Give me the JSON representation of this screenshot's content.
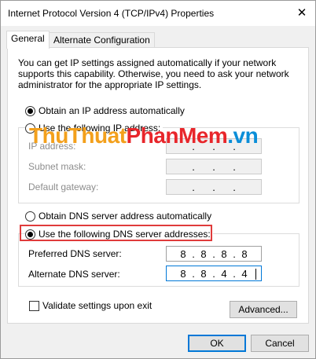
{
  "window": {
    "title": "Internet Protocol Version 4 (TCP/IPv4) Properties"
  },
  "tabs": [
    {
      "label": "General",
      "active": true
    },
    {
      "label": "Alternate Configuration",
      "active": false
    }
  ],
  "description": "You can get IP settings assigned automatically if your network supports this capability. Otherwise, you need to ask your network administrator for the appropriate IP settings.",
  "watermark": {
    "part1": "ThuThuat",
    "part2": "PhanMem",
    "part3": ".vn"
  },
  "ip": {
    "auto_label": "Obtain an IP address automatically",
    "auto_selected": true,
    "manual_label": "Use the following IP address:",
    "manual_selected": false,
    "fields": [
      {
        "label": "IP address:",
        "octets": [
          "",
          "",
          "",
          ""
        ]
      },
      {
        "label": "Subnet mask:",
        "octets": [
          "",
          "",
          "",
          ""
        ]
      },
      {
        "label": "Default gateway:",
        "octets": [
          "",
          "",
          "",
          ""
        ]
      }
    ]
  },
  "dns": {
    "auto_label": "Obtain DNS server address automatically",
    "auto_selected": false,
    "manual_label": "Use the following DNS server addresses:",
    "manual_selected": true,
    "preferred": {
      "label": "Preferred DNS server:",
      "octets": [
        "8",
        "8",
        "8",
        "8"
      ]
    },
    "alternate": {
      "label": "Alternate DNS server:",
      "octets": [
        "8",
        "8",
        "4",
        "4"
      ]
    }
  },
  "validate": {
    "label": "Validate settings upon exit",
    "checked": false
  },
  "buttons": {
    "advanced": "Advanced...",
    "ok": "OK",
    "cancel": "Cancel"
  },
  "icons": {
    "close": "close-icon"
  },
  "colors": {
    "highlight": "#e03b3b",
    "focus": "#0078d7"
  }
}
